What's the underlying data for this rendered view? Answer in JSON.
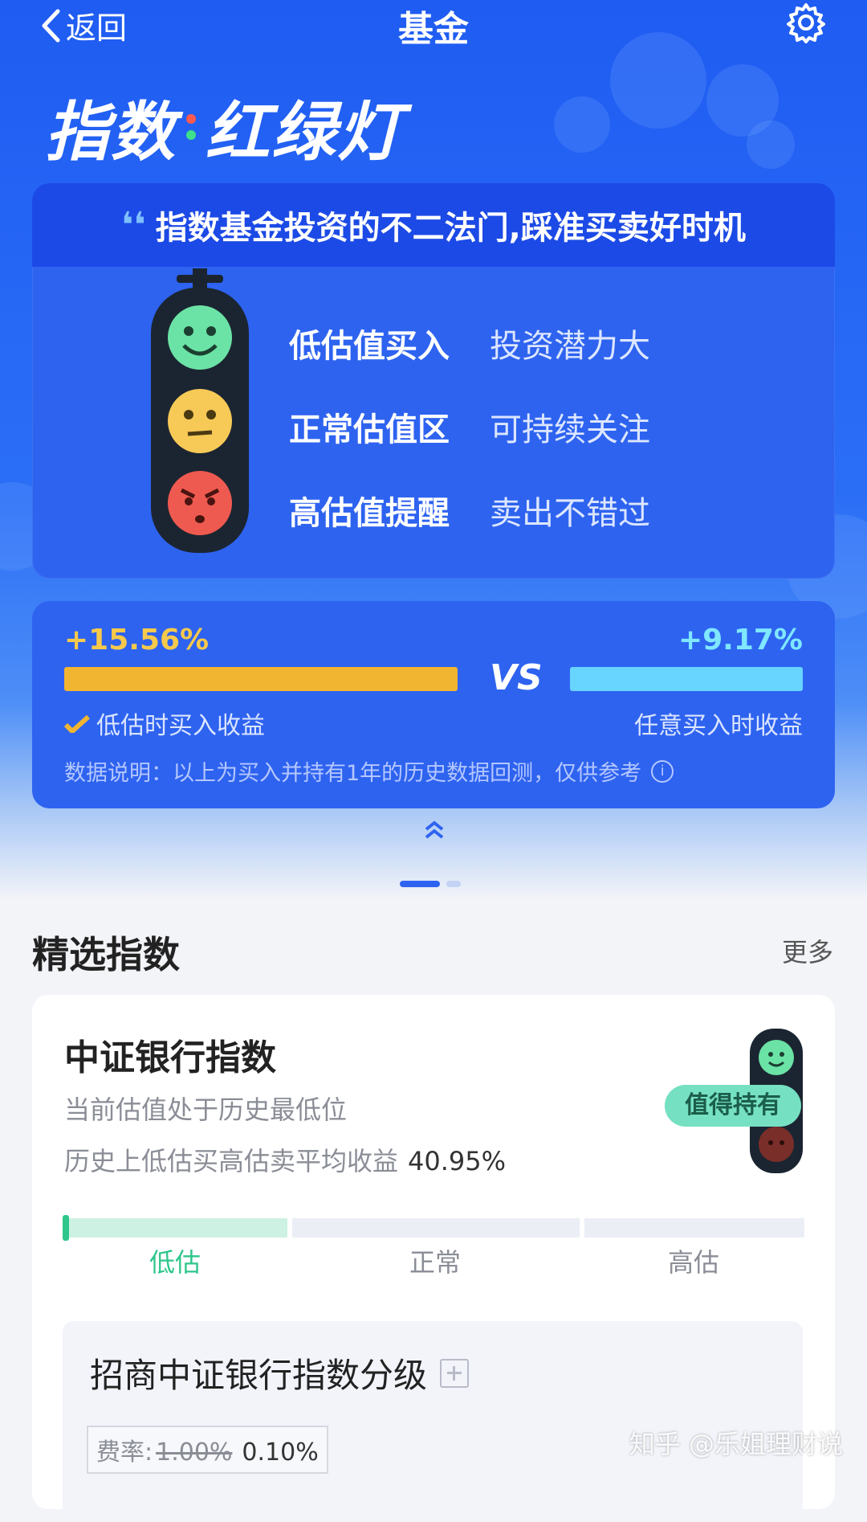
{
  "topbar": {
    "back_label": "返回",
    "title": "基金"
  },
  "hero": {
    "logo_left": "指数",
    "logo_right": "红绿灯",
    "slogan": "指数基金投资的不二法门,踩准买卖好时机",
    "rows": [
      {
        "label": "低估值买入",
        "desc": "投资潜力大"
      },
      {
        "label": "正常估值区",
        "desc": "可持续关注"
      },
      {
        "label": "高估值提醒",
        "desc": "卖出不错过"
      }
    ]
  },
  "compare": {
    "left_value": "+15.56%",
    "right_value": "+9.17%",
    "vs": "VS",
    "left_label": "低估时买入收益",
    "right_label": "任意买入时收益",
    "note": "数据说明：以上为买入并持有1年的历史数据回测，仅供参考",
    "info_icon": "i"
  },
  "section": {
    "title": "精选指数",
    "more": "更多"
  },
  "index_card": {
    "name": "中证银行指数",
    "subtitle": "当前估值处于历史最低位",
    "return_label": "历史上低估买高估卖平均收益",
    "return_value": "40.95%",
    "tag": "值得持有",
    "segments": [
      "低估",
      "正常",
      "高估"
    ],
    "current_segment": "低估"
  },
  "fund": {
    "name": "招商中证银行指数分级",
    "fee_label": "费率:",
    "fee_old": "1.00%",
    "fee_new": "0.10%"
  },
  "watermark": "知乎 @乐姐理财说",
  "colors": {
    "accent": "#2e63f0",
    "green": "#2ec68b",
    "yellow": "#f2b531",
    "cyan": "#67d5ff"
  }
}
